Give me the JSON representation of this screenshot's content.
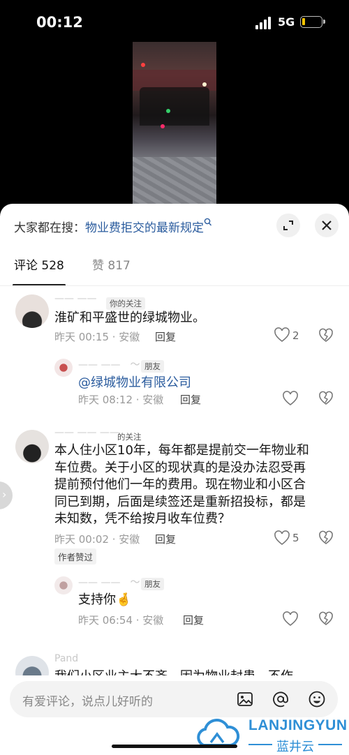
{
  "status_bar": {
    "time": "00:12",
    "network": "5G",
    "battery_level": 0.15
  },
  "search": {
    "prefix": "大家都在搜：",
    "query": "物业费拒交的最新规定",
    "icon": "search-icon"
  },
  "tabs": [
    {
      "label": "评论 528",
      "active": true
    },
    {
      "label": "赞 817",
      "active": false
    }
  ],
  "comments": [
    {
      "tag": "你的关注",
      "text": "淮矿和平盛世的绿城物业。",
      "meta": "昨天 00:15 · 安徽",
      "reply": "回复",
      "likes": "2"
    },
    {
      "tag": "朋友",
      "mention": "@绿城物业有限公司",
      "meta": "昨天 08:12 · 安徽",
      "reply": "回复"
    },
    {
      "tag": "的关注",
      "lines": [
        "本人住小区10年，每年都是提前交一年物业和",
        "车位费。关于小区的现状真的是没办法忍受再",
        "提前预付他们一年的费用。现在物业和小区合",
        "同已到期，后面是续签还是重新招投标，都是",
        "未知数，凭不给按月收车位费？"
      ],
      "meta": "昨天 00:02 · 安徽",
      "reply": "回复",
      "likes": "5",
      "badge": "作者赞过"
    },
    {
      "tag": "朋友",
      "text": "支持你",
      "emoji": "🤞",
      "meta": "昨天 06:54 · 安徽",
      "reply": "回复"
    },
    {
      "username": "Pand",
      "partial_text": "我们小区业主大不齐，因为物业封患，不作"
    }
  ],
  "input": {
    "placeholder": "有爱评论，说点儿好听的"
  },
  "watermark": {
    "en": "LANJINGYUN",
    "cn": "蓝井云"
  },
  "colors": {
    "accent": "#2b5c9e",
    "watermark": "#2f8fd6"
  }
}
